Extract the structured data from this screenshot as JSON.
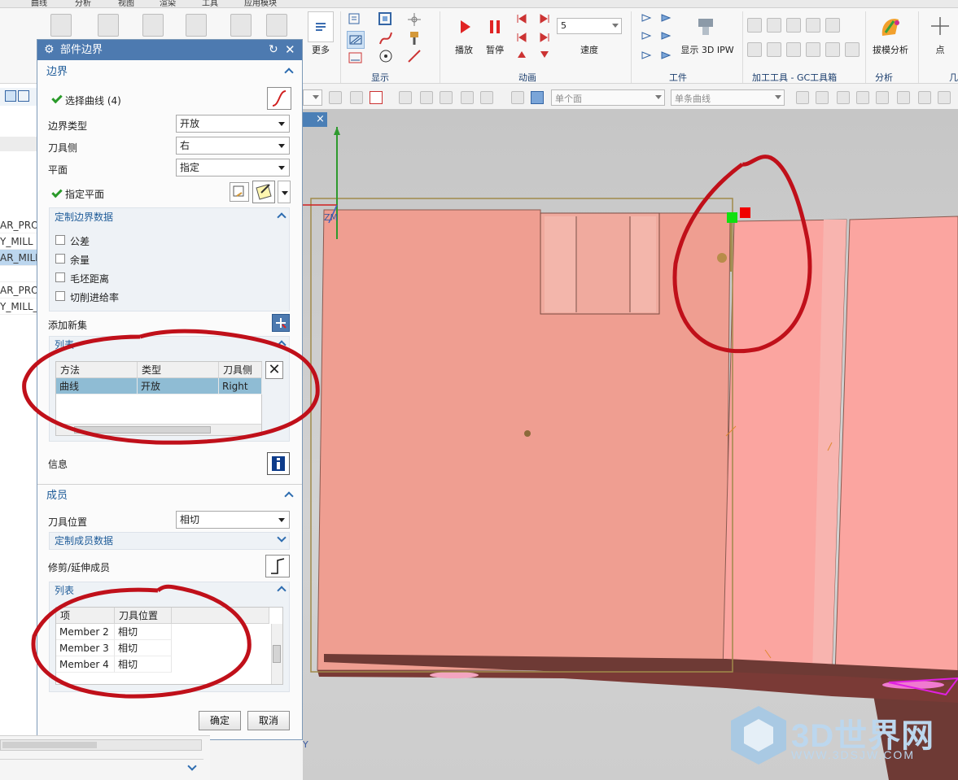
{
  "ribbon": {
    "more_label": "更多",
    "play_label": "播放",
    "pause_label": "暂停",
    "speed_value": "5",
    "speed_label": "速度",
    "ipw_label": "显示 3D IPW",
    "draft_label": "拔模分析",
    "point_label": "点",
    "groups": {
      "display": "显示",
      "animation": "动画",
      "workpiece": "工件",
      "machining_tools": "加工工具 - GC工具箱",
      "analysis": "分析",
      "partial": "几"
    }
  },
  "toolbar2": {
    "face_filter": "单个面",
    "curve_filter": "单条曲线"
  },
  "navigator": {
    "rows": [
      "AR_PROF",
      "Y_MILL",
      "AR_MILL",
      "",
      "AR_PROF",
      "Y_MILL_"
    ]
  },
  "dialog": {
    "title": "部件边界",
    "boundary_section": "边界",
    "select_curve": "选择曲线 (4)",
    "boundary_type_label": "边界类型",
    "boundary_type_value": "开放",
    "tool_side_label": "刀具侧",
    "tool_side_value": "右",
    "plane_label": "平面",
    "plane_value": "指定",
    "specify_plane": "指定平面",
    "custom_boundary_data": "定制边界数据",
    "checkboxes": [
      "公差",
      "余量",
      "毛坯距离",
      "切削进给率"
    ],
    "add_new_set": "添加新集",
    "list_label": "列表",
    "boundary_table": {
      "headers": [
        "方法",
        "类型",
        "刀具侧"
      ],
      "rows": [
        [
          "曲线",
          "开放",
          "Right"
        ]
      ]
    },
    "info_label": "信息",
    "members_section": "成员",
    "tool_position_label": "刀具位置",
    "tool_position_value": "相切",
    "custom_member_data": "定制成员数据",
    "trim_extend_label": "修剪/延伸成员",
    "member_list_label": "列表",
    "member_table": {
      "headers": [
        "项",
        "刀具位置"
      ],
      "rows": [
        [
          "Member 2",
          "相切"
        ],
        [
          "Member 3",
          "相切"
        ],
        [
          "Member 4",
          "相切"
        ]
      ]
    },
    "ok_label": "确定",
    "cancel_label": "取消"
  },
  "viewport": {
    "zm_label": "ZM",
    "y_axis_label": "Y"
  },
  "watermark": {
    "brand": "3D世界网",
    "url": "WWW.3DSJW.COM"
  },
  "colors": {
    "dialog_title": "#4d7ab0",
    "model_face": "#ee9f92",
    "annotation": "#c0101a"
  }
}
